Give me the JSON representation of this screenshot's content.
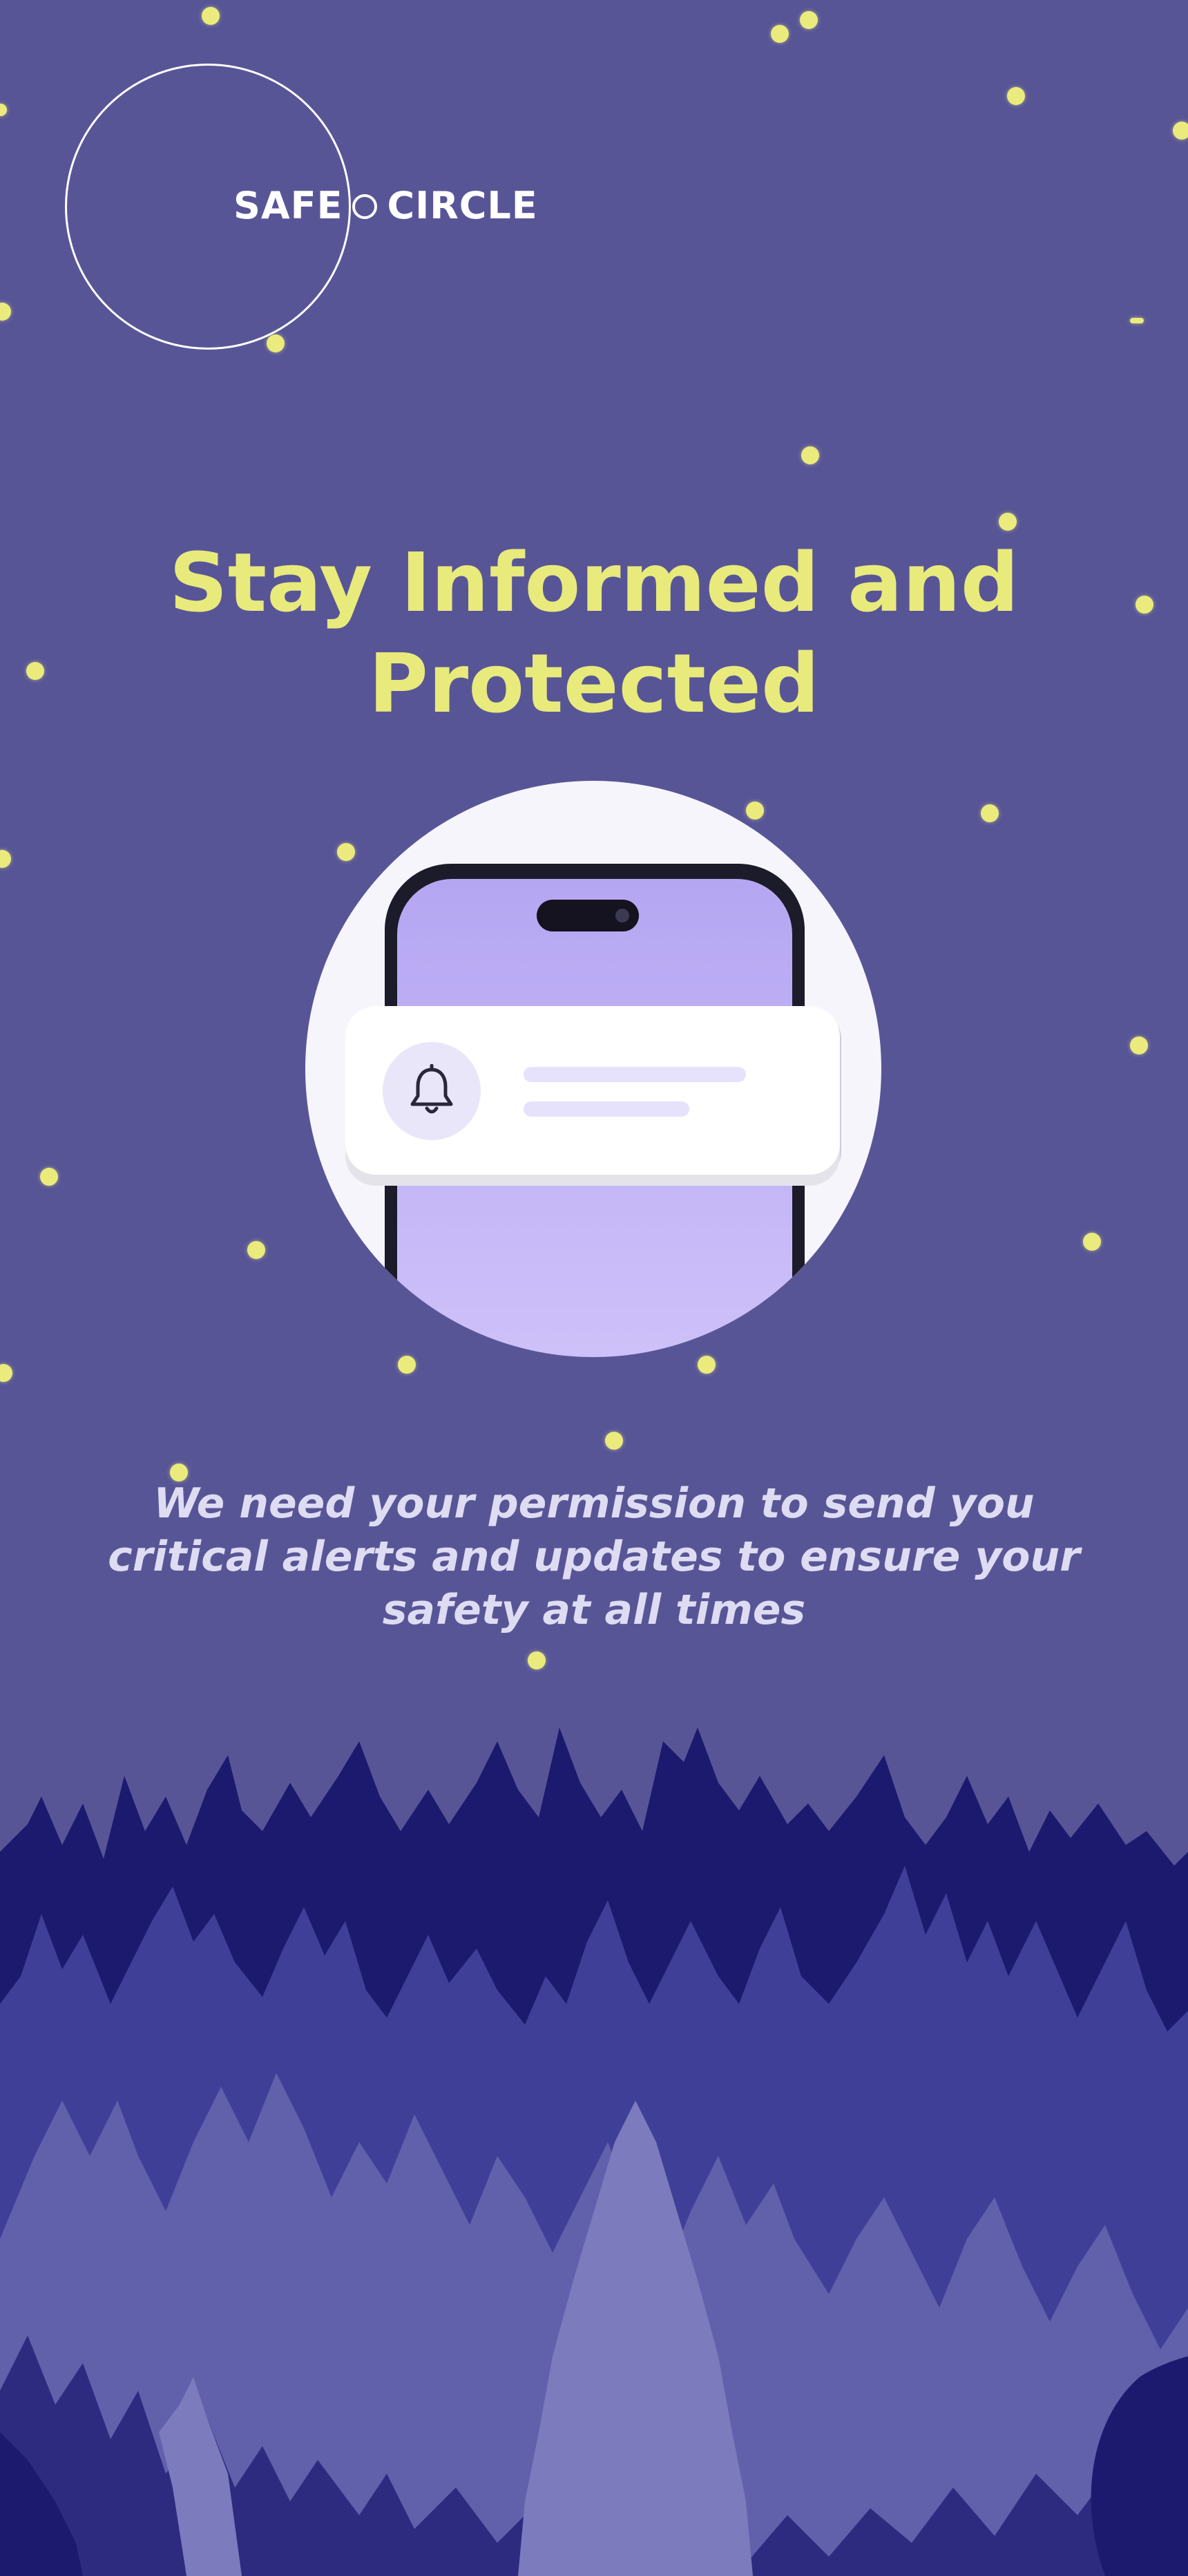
{
  "app": {
    "brand_left": "SAFE",
    "brand_right": "CIRCLE",
    "logo_name": "Safe Circle"
  },
  "main": {
    "title_line1": "Stay Informed and",
    "title_line2": "Protected",
    "message": "We need your permission to send you critical alerts and updates to ensure your safety at all times"
  },
  "illustration": {
    "icon": "bell-icon",
    "device": "phone"
  },
  "colors": {
    "background": "#585597",
    "title": "#e8ea7c",
    "star": "#eaeb7c",
    "message": "#dedcf2",
    "forest_dark": "#1b1a6e",
    "forest_mid": "#3f3e96",
    "forest_light": "#7b7bbd"
  }
}
